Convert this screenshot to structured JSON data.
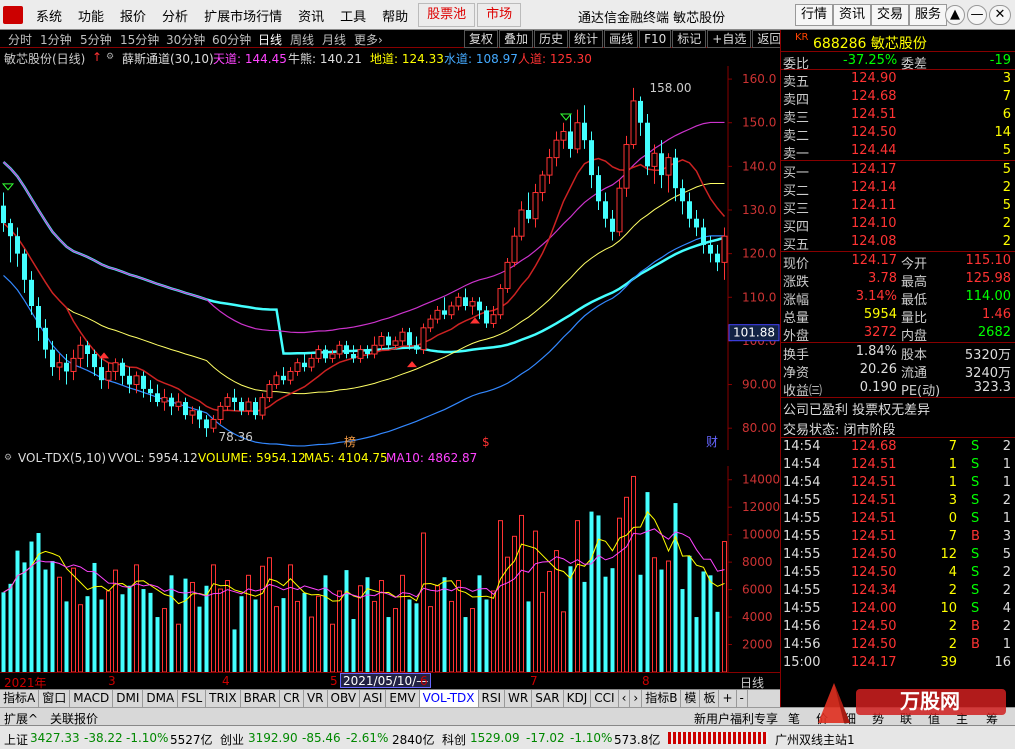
{
  "menu": [
    "系统",
    "功能",
    "报价",
    "分析",
    "扩展市场行情",
    "资讯",
    "工具",
    "帮助"
  ],
  "menu_red": [
    "股票池",
    "市场"
  ],
  "app_title": "通达信金融终端 敏芯股份",
  "top_right_btns": [
    "行情",
    "资讯",
    "交易",
    "服务"
  ],
  "win_btns": [
    "▲",
    "—",
    "□",
    "✕"
  ],
  "periods": [
    "分时",
    "1分钟",
    "5分钟",
    "15分钟",
    "30分钟",
    "60分钟",
    "日线",
    "周线",
    "月线",
    "更多›"
  ],
  "active_period": "日线",
  "tool_btns": [
    "复权",
    "叠加",
    "历史",
    "统计",
    "画线",
    "F10",
    "标记",
    "+自选",
    "返回"
  ],
  "kinfo": {
    "stock": "敏芯股份(日线)",
    "ind": "薛斯通道(30,10)",
    "tian": "天道: 144.45",
    "niu": "牛熊: 140.21",
    "di": "地道: 124.33",
    "shui": "水道: 108.97",
    "ren": "人道: 125.30"
  },
  "k_yaxis": [
    "160.0",
    "150.0",
    "140.0",
    "130.0",
    "120.0",
    "110.0",
    "100.0",
    "90.00",
    "80.00"
  ],
  "k_badge": "101.88",
  "k_high": "158.00",
  "k_low": "78.36",
  "k_markers": [
    "榜",
    "$",
    "财"
  ],
  "volinfo": {
    "name": "VOL-TDX(5,10)",
    "vol": "VVOL: 5954.12",
    "volume": "VOLUME: 5954.12",
    "ma5": "MA5: 4104.75",
    "ma10": "MA10: 4862.87"
  },
  "v_yaxis": [
    "14000",
    "12000",
    "10000",
    "8000",
    "6000",
    "4000",
    "2000"
  ],
  "xaxis": {
    "year": "2021年",
    "months": [
      "3",
      "4",
      "5",
      "6",
      "7",
      "8"
    ],
    "daybox": "2021/05/10/—",
    "right_label": "日线"
  },
  "ind_tabs": [
    "指标A",
    "窗口",
    "MACD",
    "DMI",
    "DMA",
    "FSL",
    "TRIX",
    "BRAR",
    "CR",
    "VR",
    "OBV",
    "ASI",
    "EMV",
    "VOL-TDX",
    "RSI",
    "WR",
    "SAR",
    "KDJ",
    "CCI",
    "‹",
    "›",
    "指标B",
    "模",
    "板",
    "+",
    "-"
  ],
  "active_tab": "VOL-TDX",
  "ext": [
    "扩展^",
    "关联报价"
  ],
  "right": {
    "code": "688286",
    "name": "敏芯股份",
    "kr": "KR",
    "weibi": {
      "l": "委比",
      "v": "-37.25%",
      "l2": "委差",
      "v2": "-19"
    },
    "sells": [
      {
        "l": "卖五",
        "p": "124.90",
        "q": "3"
      },
      {
        "l": "卖四",
        "p": "124.68",
        "q": "7"
      },
      {
        "l": "卖三",
        "p": "124.51",
        "q": "6"
      },
      {
        "l": "卖二",
        "p": "124.50",
        "q": "14"
      },
      {
        "l": "卖一",
        "p": "124.44",
        "q": "5"
      }
    ],
    "buys": [
      {
        "l": "买一",
        "p": "124.17",
        "q": "5"
      },
      {
        "l": "买二",
        "p": "124.14",
        "q": "2"
      },
      {
        "l": "买三",
        "p": "124.11",
        "q": "5"
      },
      {
        "l": "买四",
        "p": "124.10",
        "q": "2"
      },
      {
        "l": "买五",
        "p": "124.08",
        "q": "2"
      }
    ],
    "stats": [
      {
        "l": "现价",
        "v": "124.17",
        "l2": "今开",
        "v2": "115.10"
      },
      {
        "l": "涨跌",
        "v": "3.78",
        "l2": "最高",
        "v2": "125.98"
      },
      {
        "l": "涨幅",
        "v": "3.14%",
        "l2": "最低",
        "v2": "114.00"
      },
      {
        "l": "总量",
        "v": "5954",
        "l2": "量比",
        "v2": "1.46"
      },
      {
        "l": "外盘",
        "v": "3272",
        "l2": "内盘",
        "v2": "2682"
      }
    ],
    "fund": [
      {
        "l": "换手",
        "v": "1.84%",
        "l2": "股本",
        "v2": "5320万"
      },
      {
        "l": "净资",
        "v": "20.26",
        "l2": "流通",
        "v2": "3240万"
      },
      {
        "l": "收益㈢",
        "v": "0.190",
        "l2": "PE(动)",
        "v2": "323.3"
      }
    ],
    "note1": "公司已盈利 投票权无差异",
    "note2": "交易状态: 闭市阶段",
    "ticks": [
      {
        "t": "14:54",
        "p": "124.68",
        "q": "7",
        "s": "S",
        "n": "2"
      },
      {
        "t": "14:54",
        "p": "124.51",
        "q": "1",
        "s": "S",
        "n": "1"
      },
      {
        "t": "14:54",
        "p": "124.51",
        "q": "1",
        "s": "S",
        "n": "1"
      },
      {
        "t": "14:55",
        "p": "124.51",
        "q": "3",
        "s": "S",
        "n": "2"
      },
      {
        "t": "14:55",
        "p": "124.51",
        "q": "0",
        "s": "S",
        "n": "1"
      },
      {
        "t": "14:55",
        "p": "124.51",
        "q": "7",
        "s": "B",
        "n": "3"
      },
      {
        "t": "14:55",
        "p": "124.50",
        "q": "12",
        "s": "S",
        "n": "5"
      },
      {
        "t": "14:55",
        "p": "124.50",
        "q": "4",
        "s": "S",
        "n": "2"
      },
      {
        "t": "14:55",
        "p": "124.34",
        "q": "2",
        "s": "S",
        "n": "2"
      },
      {
        "t": "14:55",
        "p": "124.00",
        "q": "10",
        "s": "S",
        "n": "4"
      },
      {
        "t": "14:56",
        "p": "124.50",
        "q": "2",
        "s": "B",
        "n": "2"
      },
      {
        "t": "14:56",
        "p": "124.50",
        "q": "2",
        "s": "B",
        "n": "1"
      },
      {
        "t": "15:00",
        "p": "124.17",
        "q": "39",
        "s": "",
        "n": "16"
      }
    ]
  },
  "rbar": [
    "新用户福利专享",
    "笔",
    "价",
    "细",
    "势",
    "联",
    "值",
    "主",
    "筹"
  ],
  "status": {
    "sh": "上证",
    "sh_v": "3427.33",
    "sh_c": "-38.22",
    "sh_p": "-1.10%",
    "sh_a": "5527亿",
    "cy": "创业",
    "cy_v": "3192.90",
    "cy_c": "-85.46",
    "cy_p": "-2.61%",
    "cy_a": "2840亿",
    "kc": "科创",
    "kc_v": "1529.09",
    "kc_c": "-17.02",
    "kc_p": "-1.10%",
    "kc_a": "573.8亿",
    "site": "广州双线主站1"
  },
  "watermark": {
    "brand": "万股网",
    "url": "www.2010..."
  },
  "chart_data": {
    "type": "candlestick",
    "y_range": [
      75,
      163
    ],
    "candles": [
      [
        131,
        127,
        134,
        125
      ],
      [
        127,
        124,
        128,
        118
      ],
      [
        124,
        120,
        126,
        117
      ],
      [
        120,
        114,
        121,
        111
      ],
      [
        114,
        108,
        116,
        106
      ],
      [
        108,
        103,
        110,
        100
      ],
      [
        103,
        98,
        105,
        96
      ],
      [
        98,
        94,
        100,
        92
      ],
      [
        94,
        95,
        97,
        91
      ],
      [
        95,
        93,
        97,
        90
      ],
      [
        93,
        96,
        98,
        91
      ],
      [
        96,
        99,
        101,
        94
      ],
      [
        99,
        97,
        100,
        94
      ],
      [
        97,
        94,
        98,
        92
      ],
      [
        94,
        91,
        96,
        89
      ],
      [
        91,
        93,
        95,
        89
      ],
      [
        93,
        95,
        96,
        91
      ],
      [
        95,
        92,
        96,
        90
      ],
      [
        92,
        90,
        94,
        88
      ],
      [
        90,
        92,
        93,
        88
      ],
      [
        92,
        89,
        93,
        87
      ],
      [
        89,
        88,
        91,
        86
      ],
      [
        88,
        86,
        90,
        85
      ],
      [
        86,
        87,
        89,
        84
      ],
      [
        87,
        85,
        88,
        83
      ],
      [
        85,
        86,
        88,
        84
      ],
      [
        86,
        83,
        87,
        82
      ],
      [
        83,
        84,
        85,
        81
      ],
      [
        84,
        82,
        85,
        80
      ],
      [
        82,
        80,
        83,
        78
      ],
      [
        80,
        82,
        83,
        79
      ],
      [
        82,
        85,
        86,
        81
      ],
      [
        85,
        87,
        88,
        84
      ],
      [
        87,
        86,
        89,
        84
      ],
      [
        86,
        84,
        87,
        83
      ],
      [
        84,
        86,
        87,
        83
      ],
      [
        86,
        83,
        87,
        82
      ],
      [
        83,
        87,
        88,
        82
      ],
      [
        87,
        90,
        91,
        86
      ],
      [
        90,
        92,
        93,
        89
      ],
      [
        92,
        91,
        94,
        90
      ],
      [
        91,
        93,
        94,
        90
      ],
      [
        93,
        95,
        96,
        92
      ],
      [
        95,
        94,
        97,
        93
      ],
      [
        94,
        96,
        97,
        93
      ],
      [
        96,
        98,
        99,
        95
      ],
      [
        98,
        96,
        99,
        95
      ],
      [
        96,
        97,
        98,
        95
      ],
      [
        97,
        99,
        100,
        96
      ],
      [
        99,
        97,
        100,
        96
      ],
      [
        97,
        96,
        99,
        95
      ],
      [
        96,
        98,
        99,
        95
      ],
      [
        98,
        97,
        99,
        96
      ],
      [
        97,
        99,
        101,
        96
      ],
      [
        99,
        101,
        102,
        98
      ],
      [
        101,
        99,
        102,
        98
      ],
      [
        99,
        100,
        101,
        98
      ],
      [
        100,
        102,
        103,
        99
      ],
      [
        102,
        99,
        103,
        98
      ],
      [
        99,
        98,
        101,
        97
      ],
      [
        98,
        103,
        104,
        97
      ],
      [
        103,
        105,
        106,
        102
      ],
      [
        105,
        107,
        108,
        104
      ],
      [
        107,
        106,
        110,
        105
      ],
      [
        106,
        108,
        109,
        105
      ],
      [
        108,
        110,
        111,
        107
      ],
      [
        110,
        108,
        112,
        107
      ],
      [
        108,
        109,
        110,
        106
      ],
      [
        109,
        107,
        110,
        105
      ],
      [
        107,
        104,
        108,
        103
      ],
      [
        104,
        106,
        108,
        103
      ],
      [
        106,
        112,
        113,
        105
      ],
      [
        112,
        118,
        119,
        111
      ],
      [
        118,
        124,
        126,
        117
      ],
      [
        124,
        130,
        132,
        123
      ],
      [
        130,
        128,
        134,
        127
      ],
      [
        128,
        134,
        136,
        126
      ],
      [
        134,
        138,
        139,
        132
      ],
      [
        138,
        142,
        144,
        136
      ],
      [
        142,
        146,
        148,
        140
      ],
      [
        146,
        148,
        150,
        144
      ],
      [
        148,
        144,
        152,
        142
      ],
      [
        144,
        150,
        153,
        143
      ],
      [
        150,
        146,
        154,
        144
      ],
      [
        146,
        138,
        148,
        135
      ],
      [
        138,
        132,
        140,
        130
      ],
      [
        132,
        128,
        134,
        126
      ],
      [
        128,
        125,
        130,
        123
      ],
      [
        125,
        135,
        137,
        124
      ],
      [
        135,
        145,
        147,
        133
      ],
      [
        145,
        155,
        158,
        144
      ],
      [
        155,
        150,
        156,
        147
      ],
      [
        150,
        140,
        152,
        138
      ],
      [
        140,
        143,
        145,
        136
      ],
      [
        143,
        138,
        146,
        135
      ],
      [
        138,
        142,
        143,
        134
      ],
      [
        142,
        135,
        144,
        132
      ],
      [
        135,
        132,
        137,
        129
      ],
      [
        132,
        128,
        134,
        126
      ],
      [
        128,
        126,
        130,
        124
      ],
      [
        126,
        122,
        128,
        120
      ],
      [
        122,
        120,
        124,
        118
      ],
      [
        120,
        118,
        122,
        116
      ],
      [
        118,
        124,
        126,
        114
      ]
    ],
    "volume_ma_labels": [
      "MA5",
      "MA10"
    ]
  }
}
